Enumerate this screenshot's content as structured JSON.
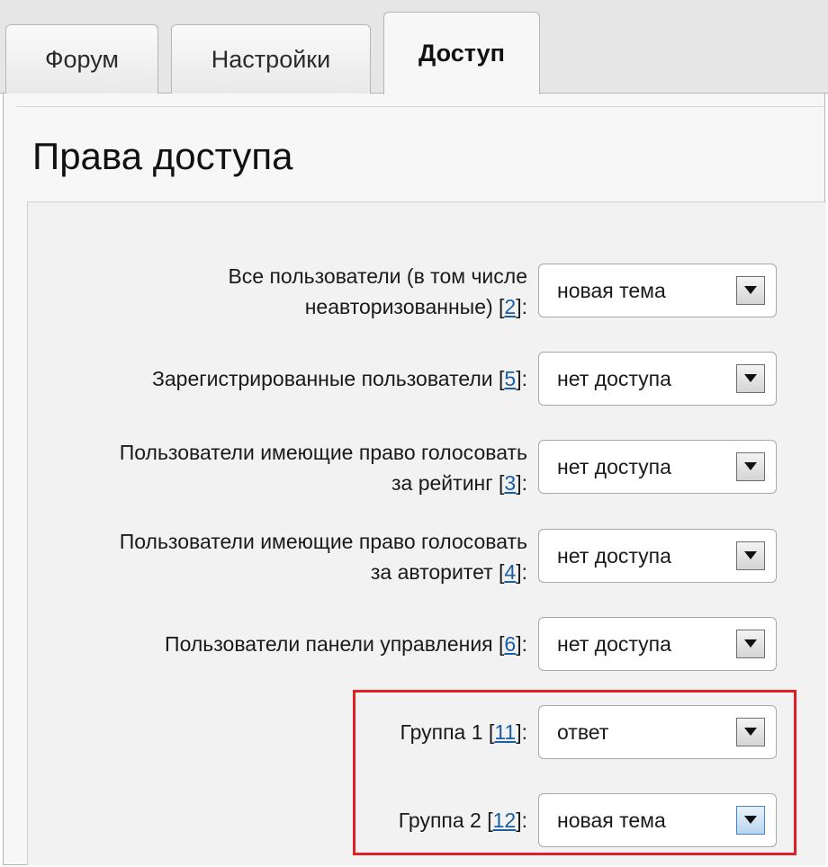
{
  "tabs": {
    "forum": "Форум",
    "settings": "Настройки",
    "access": "Доступ"
  },
  "page": {
    "title": "Права доступа"
  },
  "rows": [
    {
      "label_lines": [
        "Все пользователи (в том числе",
        "неавторизованные)"
      ],
      "ref": "2",
      "suffix": ":",
      "value": "новая тема"
    },
    {
      "label_lines": [
        "Зарегистрированные пользователи"
      ],
      "ref": "5",
      "suffix": ":",
      "value": "нет доступа"
    },
    {
      "label_lines": [
        "Пользователи имеющие право голосовать",
        "за рейтинг"
      ],
      "ref": "3",
      "suffix": ":",
      "value": "нет доступа"
    },
    {
      "label_lines": [
        "Пользователи имеющие право голосовать",
        "за авторитет"
      ],
      "ref": "4",
      "suffix": ":",
      "value": "нет доступа"
    },
    {
      "label_lines": [
        "Пользователи панели управления"
      ],
      "ref": "6",
      "suffix": ":",
      "value": "нет доступа"
    },
    {
      "label_lines": [
        "Группа 1"
      ],
      "ref": "11",
      "suffix": ":",
      "value": "ответ"
    },
    {
      "label_lines": [
        "Группа 2"
      ],
      "ref": "12",
      "suffix": ":",
      "value": "новая тема"
    }
  ],
  "colors": {
    "highlight": "#e01f26",
    "link": "#1a5ea8",
    "focused_arrow": "#4a84c4"
  },
  "icons": {
    "dropdown": "chevron-down-icon"
  }
}
